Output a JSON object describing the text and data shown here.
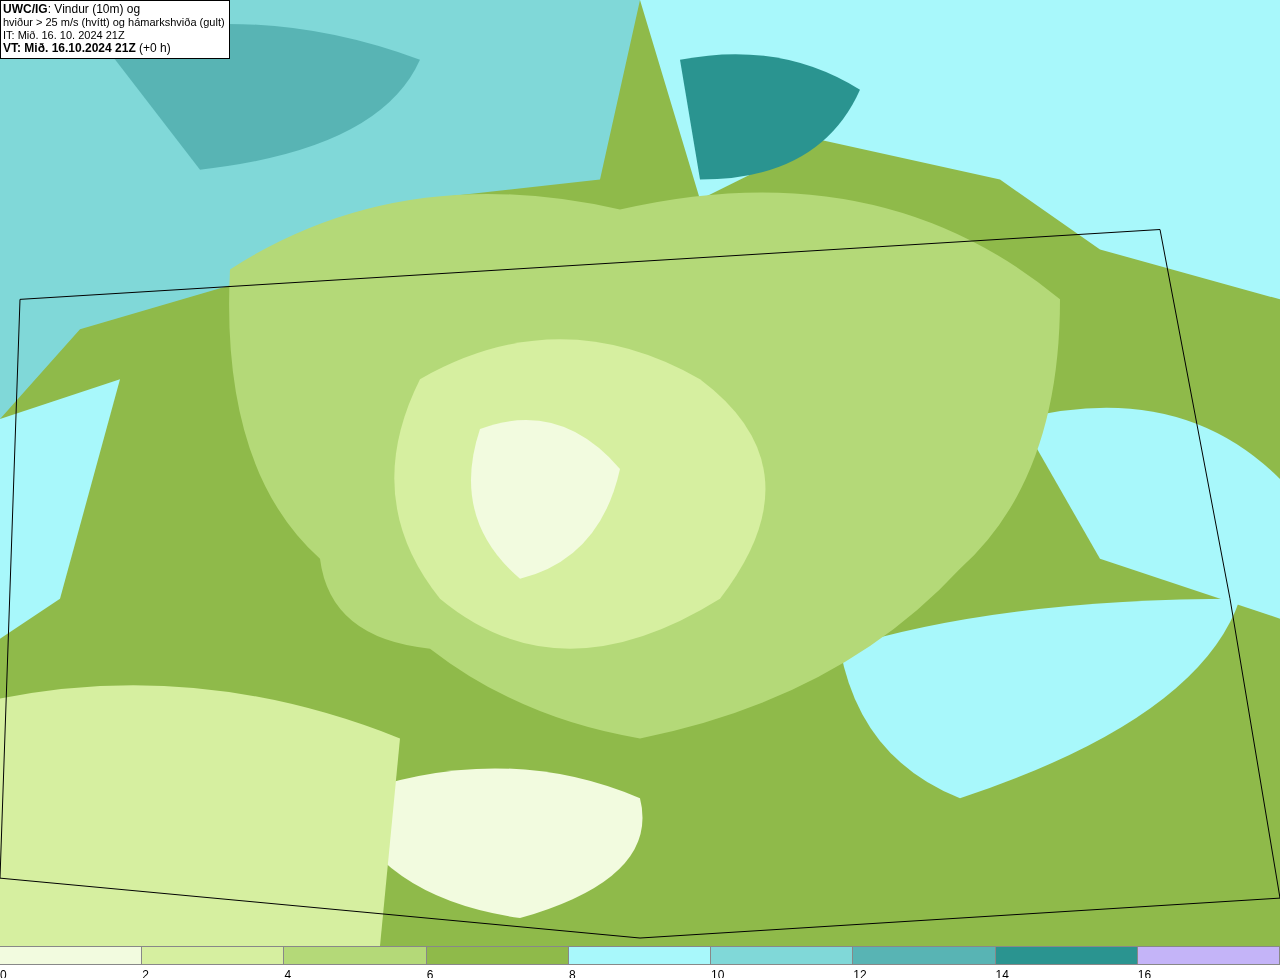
{
  "title_box": {
    "lines": [
      {
        "kind": "title",
        "text": "**UWC/IG**: Vindur (10m) og"
      },
      {
        "kind": "subtitle",
        "text": "hviður > 25 m/s (hvítt) og hámarkshviða (gult)"
      },
      {
        "kind": "issue",
        "text": "IT: Mið. 16. 10. 2024 21Z"
      },
      {
        "kind": "valid",
        "text": "**VT: Mið. 16.10.2024 21Z** (+0 h)"
      }
    ]
  },
  "legend": [
    {
      "label": "0",
      "color": "#f2fbdf"
    },
    {
      "label": "2",
      "color": "#d6efa0"
    },
    {
      "label": "4",
      "color": "#b4d978"
    },
    {
      "label": "6",
      "color": "#8fba4a"
    },
    {
      "label": "8",
      "color": "#a8f8fb"
    },
    {
      "label": "10",
      "color": "#80d8d8"
    },
    {
      "label": "12",
      "color": "#58b4b4"
    },
    {
      "label": "14",
      "color": "#2a9490"
    },
    {
      "label": "16",
      "color": "#c4b4f8"
    }
  ]
}
